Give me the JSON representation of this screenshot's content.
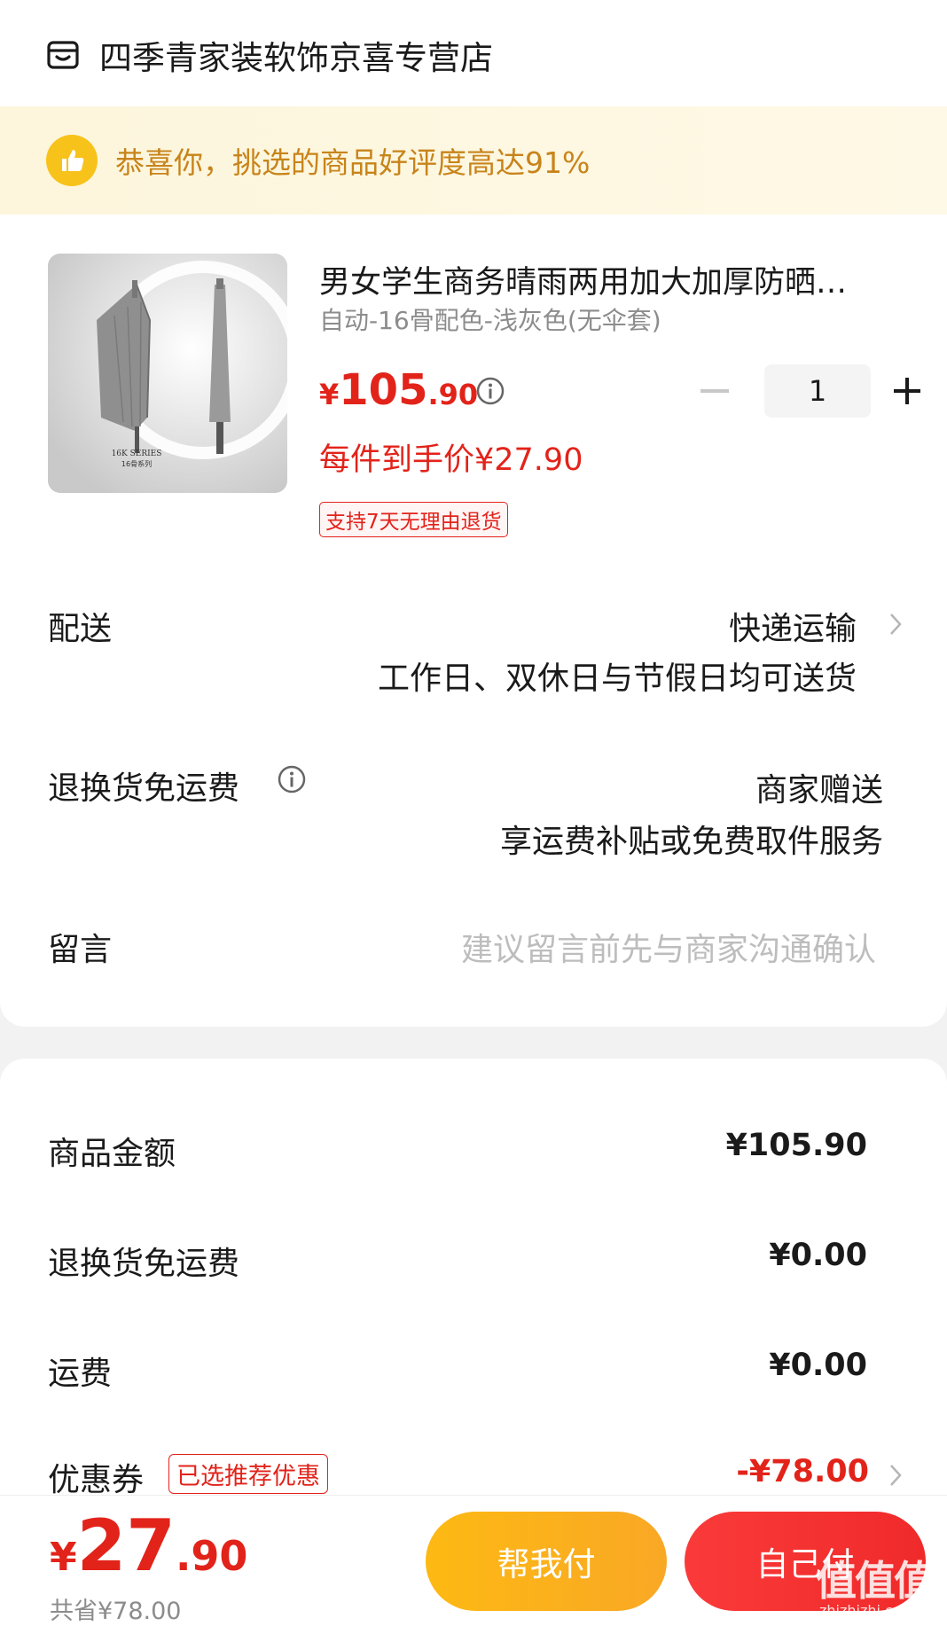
{
  "store": {
    "name": "四季青家装软饰京喜专营店"
  },
  "banner": {
    "text": "恭喜你，挑选的商品好评度高达91%"
  },
  "product": {
    "title": "男女学生商务晴雨两用加大加厚防晒…",
    "spec": "自动-16骨配色-浅灰色(无伞套)",
    "price": {
      "currency": "¥",
      "integer": "105",
      "decimal": ".90"
    },
    "quantity": "1",
    "hand_price": "每件到手价¥27.90",
    "return_tag": "支持7天无理由退货",
    "image_text": {
      "series": "16K SERIES",
      "sub": "16骨系列"
    }
  },
  "delivery": {
    "label": "配送",
    "method": "快递运输",
    "note": "工作日、双休日与节假日均可送货"
  },
  "return_shipping": {
    "label": "退换货免运费",
    "value": "商家赠送",
    "note": "享运费补贴或免费取件服务"
  },
  "message": {
    "label": "留言",
    "placeholder": "建议留言前先与商家沟通确认"
  },
  "summary": {
    "goods_label": "商品金额",
    "goods_value": "¥105.90",
    "return_label": "退换货免运费",
    "return_value": "¥0.00",
    "shipping_label": "运费",
    "shipping_value": "¥0.00",
    "coupon_label": "优惠券",
    "coupon_tag": "已选推荐优惠",
    "coupon_value": "-¥78.00"
  },
  "bottom": {
    "total": {
      "currency": "¥",
      "integer": "27",
      "decimal": ".90"
    },
    "saved": "共省¥78.00",
    "help_pay": "帮我付",
    "self_pay": "自己付"
  },
  "watermark": {
    "text": "值值值",
    "sub": "zhizhizhi.com"
  },
  "colors": {
    "accent_red": "#e2231a",
    "banner_text": "#c8841a",
    "help_btn": "#fdb913",
    "self_btn": "#f02a2a"
  },
  "icons": {
    "store": "store-icon",
    "thumb": "thumbs-up-icon",
    "info": "info-icon",
    "chevron": "chevron-right-icon"
  }
}
